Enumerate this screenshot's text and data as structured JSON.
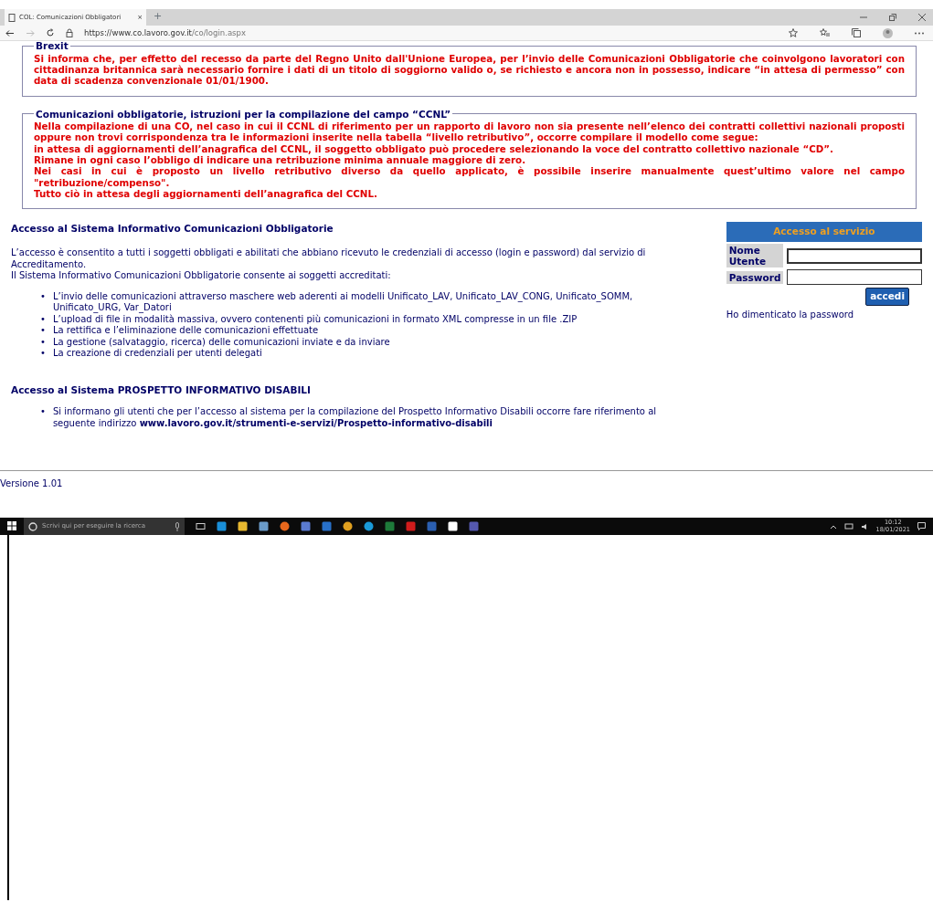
{
  "browser": {
    "tab_title": "COL: Comunicazioni Obbligatori",
    "tab_close": "×",
    "new_tab": "+",
    "url_host": "https://www.co.lavoro.gov.it",
    "url_path": "/co/login.aspx"
  },
  "notices": [
    {
      "legend": "Brexit",
      "lines": [
        "Si informa che, per effetto del recesso da parte del Regno Unito dall'Unione Europea, per l’invio delle Comunicazioni Obbligatorie che coinvolgono lavoratori con cittadinanza britannica sarà necessario fornire i dati di un titolo di soggiorno valido o, se richiesto e ancora non in possesso, indicare “in attesa di permesso” con data di scadenza convenzionale 01/01/1900."
      ]
    },
    {
      "legend": "Comunicazioni obbligatorie, istruzioni per la compilazione del campo “CCNL”",
      "lines": [
        "Nella compilazione di una CO, nel caso in cui il CCNL di riferimento per un rapporto di lavoro non sia presente nell’elenco dei contratti collettivi nazionali proposti oppure non trovi corrispondenza tra le informazioni inserite nella tabella “livello retributivo”, occorre compilare il modello come segue:",
        "in attesa di aggiornamenti dell’anagrafica del CCNL, il soggetto obbligato può procedere selezionando la voce del contratto collettivo nazionale “CD”.",
        "Rimane in ogni caso l’obbligo di indicare una retribuzione minima annuale maggiore di zero.",
        "Nei casi in cui è proposto un livello retributivo diverso da quello applicato, è possibile inserire manualmente quest’ultimo valore nel campo \"retribuzione/compenso\".",
        "Tutto ciò in attesa degli aggiornamenti dell’anagrafica del CCNL."
      ]
    }
  ],
  "access": {
    "heading": "Accesso al Sistema Informativo Comunicazioni Obbligatorie",
    "bullet": "•",
    "paragraphs": [
      "L’accesso è consentito a tutti i soggetti obbligati e abilitati che abbiano ricevuto le credenziali di accesso (login e password) dal servizio di Accreditamento.",
      "Il Sistema Informativo Comunicazioni Obbligatorie consente ai soggetti accreditati:"
    ],
    "items": [
      "L’invio delle comunicazioni attraverso maschere web aderenti ai modelli Unificato_LAV, Unificato_LAV_CONG, Unificato_SOMM, Unificato_URG, Var_Datori",
      "L’upload di file in modalità massiva, ovvero contenenti più comunicazioni in formato XML compresse in un file .ZIP",
      "La rettifica e l’eliminazione delle comunicazioni effettuate",
      "La gestione (salvataggio, ricerca) delle comunicazioni inviate e da inviare",
      "La creazione di credenziali per utenti delegati"
    ]
  },
  "disabili": {
    "heading": "Accesso al Sistema PROSPETTO INFORMATIVO DISABILI",
    "bullet": "•",
    "items": [
      "Si informano gli utenti che per l’accesso al sistema per la compilazione del Prospetto Informativo Disabili occorre fare riferimento al seguente indirizzo **www.lavoro.gov.it/strumenti-e-servizi/Prospetto-informativo-disabili**"
    ]
  },
  "login": {
    "title": "Accesso al servizio",
    "fields": [
      {
        "label": "Nome Utente"
      },
      {
        "label": "Password"
      }
    ],
    "button": "accedi",
    "forgot_link": "Ho dimenticato la password"
  },
  "version": "Versione 1.01",
  "taskbar": {
    "search_placeholder": "Scrivi qui per eseguire la ricerca",
    "time": "10:12",
    "date": "18/01/2021"
  }
}
